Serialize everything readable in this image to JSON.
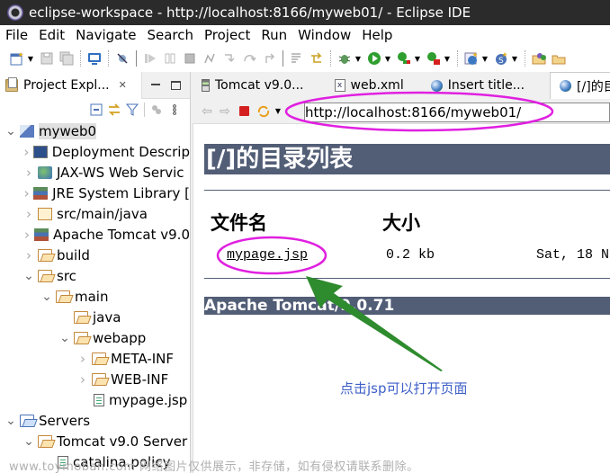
{
  "window": {
    "title": "eclipse-workspace - http://localhost:8166/myweb01/ - Eclipse IDE",
    "app_icon": "eclipse-icon"
  },
  "menubar": {
    "items": [
      "File",
      "Edit",
      "Navigate",
      "Search",
      "Project",
      "Run",
      "Window",
      "Help"
    ]
  },
  "toolbar": {
    "icons": [
      "new-icon",
      "save-icon",
      "save-all-icon",
      "console-icon",
      "skip-breakpoints-icon",
      "resume-icon",
      "suspend-icon",
      "terminate-icon",
      "disconnect-icon",
      "step-into-icon",
      "step-over-icon",
      "step-return-icon",
      "use-step-filters-icon",
      "drop-to-frame-icon",
      "debug-icon",
      "run-icon",
      "coverage-icon",
      "external-tools-icon",
      "new-server-icon",
      "new-java-class-icon",
      "open-type-icon"
    ]
  },
  "project_explorer": {
    "tab_label": "Project Expl...",
    "close_glyph": "✕",
    "tree": [
      {
        "label": "myweb0",
        "depth": 0,
        "expanded": true,
        "icon": "web-project-icon",
        "selected": true
      },
      {
        "label": "Deployment Descrip",
        "depth": 1,
        "expanded": false,
        "icon": "deployment-descriptor-icon"
      },
      {
        "label": "JAX-WS Web Servic",
        "depth": 1,
        "expanded": false,
        "icon": "jax-ws-icon"
      },
      {
        "label": "JRE System Library [",
        "depth": 1,
        "expanded": false,
        "icon": "library-icon"
      },
      {
        "label": "src/main/java",
        "depth": 1,
        "expanded": false,
        "icon": "source-folder-icon"
      },
      {
        "label": "Apache Tomcat v9.0",
        "depth": 1,
        "expanded": false,
        "icon": "library-icon"
      },
      {
        "label": "build",
        "depth": 1,
        "expanded": false,
        "icon": "folder-icon"
      },
      {
        "label": "src",
        "depth": 1,
        "expanded": true,
        "icon": "folder-icon"
      },
      {
        "label": "main",
        "depth": 2,
        "expanded": true,
        "icon": "folder-icon"
      },
      {
        "label": "java",
        "depth": 3,
        "expanded": null,
        "icon": "folder-icon"
      },
      {
        "label": "webapp",
        "depth": 3,
        "expanded": true,
        "icon": "folder-icon"
      },
      {
        "label": "META-INF",
        "depth": 4,
        "expanded": false,
        "icon": "folder-icon"
      },
      {
        "label": "WEB-INF",
        "depth": 4,
        "expanded": false,
        "icon": "folder-icon"
      },
      {
        "label": "mypage.jsp",
        "depth": 4,
        "expanded": null,
        "icon": "jsp-file-icon"
      },
      {
        "label": "Servers",
        "depth": 0,
        "expanded": true,
        "icon": "servers-folder-icon"
      },
      {
        "label": "Tomcat v9.0 Server",
        "depth": 1,
        "expanded": true,
        "icon": "folder-icon"
      },
      {
        "label": "catalina.policy",
        "depth": 2,
        "expanded": null,
        "icon": "file-icon"
      }
    ]
  },
  "editor": {
    "tabs": [
      {
        "label": "Tomcat v9.0...",
        "icon": "server-icon",
        "active": false
      },
      {
        "label": "web.xml",
        "icon": "xml-file-icon",
        "active": false
      },
      {
        "label": "Insert title...",
        "icon": "globe-icon",
        "active": false
      },
      {
        "label": "[/]的目",
        "icon": "globe-icon",
        "active": true
      }
    ],
    "browser": {
      "url": "http://localhost:8166/myweb01/"
    },
    "page": {
      "heading": "[/]的目录列表",
      "columns": [
        "文件名",
        "大小"
      ],
      "rows": [
        {
          "name": "mypage.jsp",
          "size": "0.2 kb",
          "modified": "Sat, 18 N"
        }
      ],
      "footer": "Apache Tomcat/9.0.71"
    }
  },
  "annotations": {
    "note": "点击jsp可以打开页面",
    "highlight_color": "#e020e0",
    "arrow_color": "#2e8b2e",
    "note_color": "#3d5fc7"
  },
  "watermark": "www.toymoban.com 网络图片仅供展示，非存储，如有侵权请联系删除。"
}
